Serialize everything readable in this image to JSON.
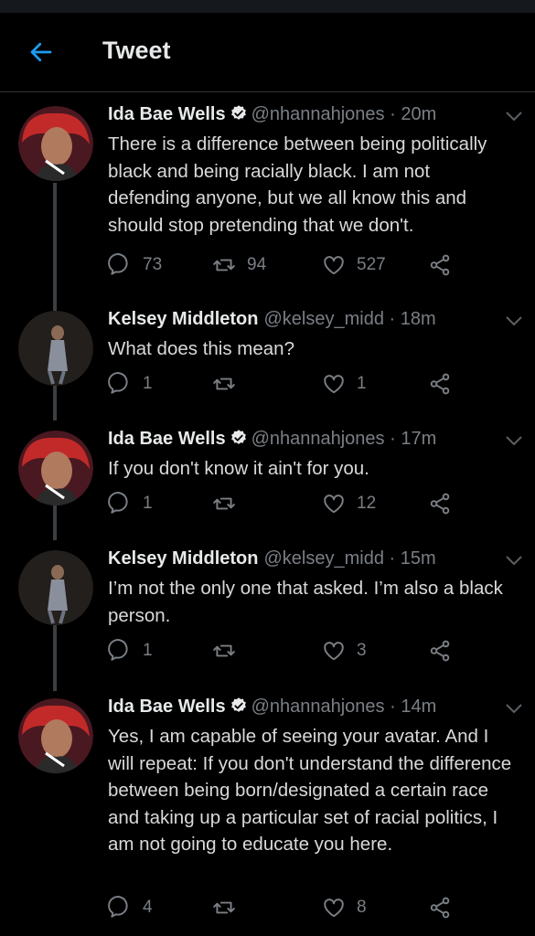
{
  "header": {
    "title": "Tweet"
  },
  "tweets": [
    {
      "name": "Ida Bae Wells",
      "verified": true,
      "handle": "@nhannahjones",
      "time": "20m",
      "text": "There is a difference between being politically black and being racially black. I am not defending anyone, but we all know this and should stop pretending that we don't.",
      "replies": "73",
      "retweets": "94",
      "likes": "527"
    },
    {
      "name": "Kelsey Middleton",
      "verified": false,
      "handle": "@kelsey_midd",
      "time": "18m",
      "text": "What does this mean?",
      "replies": "1",
      "retweets": "",
      "likes": "1"
    },
    {
      "name": "Ida Bae Wells",
      "verified": true,
      "handle": "@nhannahjones",
      "time": "17m",
      "text": "If you don't know it ain't for you.",
      "replies": "1",
      "retweets": "",
      "likes": "12"
    },
    {
      "name": "Kelsey Middleton",
      "verified": false,
      "handle": "@kelsey_midd",
      "time": "15m",
      "text": "I’m not the only one that asked. I’m also a black person.",
      "replies": "1",
      "retweets": "",
      "likes": "3"
    },
    {
      "name": "Ida Bae Wells",
      "verified": true,
      "handle": "@nhannahjones",
      "time": "14m",
      "text": "Yes, I am capable of seeing your avatar. And I will repeat: If you don't understand the difference between being born/designated a certain race and taking up a particular set of racial politics, I am not going to educate you here.",
      "replies": "4",
      "retweets": "",
      "likes": "8"
    }
  ],
  "colors": {
    "accent": "#1d9bf0",
    "background": "#000000",
    "muted": "#7a7f85",
    "thread_line": "#3a3f44"
  },
  "icons": {
    "back": "arrow-left-icon",
    "verified": "verified-badge-icon",
    "caret": "chevron-down-icon",
    "reply": "reply-icon",
    "retweet": "retweet-icon",
    "like": "heart-icon",
    "share": "share-icon"
  }
}
